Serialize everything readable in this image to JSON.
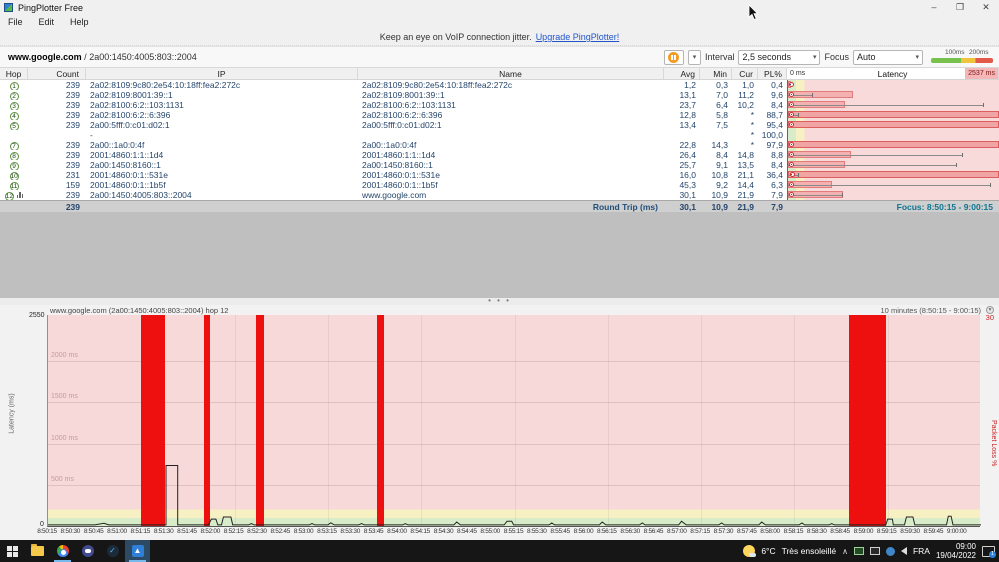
{
  "window": {
    "title": "PingPlotter Free",
    "minimize": "–",
    "maximize": "❐",
    "close": "✕"
  },
  "menu": {
    "items": [
      "File",
      "Edit",
      "Help"
    ]
  },
  "banner": {
    "text": "Keep an eye on VoIP connection jitter.",
    "link": "Upgrade PingPlotter!"
  },
  "target": {
    "host": "www.google.com",
    "separator": " / ",
    "address": "2a00:1450:4005:803::2004"
  },
  "controls": {
    "interval_label": "Interval",
    "interval_value": "2,5 seconds",
    "focus_label": "Focus",
    "focus_value": "Auto",
    "legend": {
      "low": "100ms",
      "high": "200ms"
    },
    "caret": "▾"
  },
  "table": {
    "headers": {
      "hop": "Hop",
      "count": "Count",
      "ip": "IP",
      "name": "Name",
      "avg": "Avg",
      "min": "Min",
      "cur": "Cur",
      "pl": "PL%",
      "latency": "Latency",
      "lat_min": "0 ms",
      "lat_max": "2537 ms"
    },
    "rows": [
      {
        "hop": "1",
        "count": "239",
        "ip": "2a02:8109:9c80:2e54:10:18ff:fea2:272c",
        "name": "2a02:8109:9c80:2e54:10:18ff:fea2:272c",
        "avg": "1,2",
        "min": "0,3",
        "cur": "1,0",
        "pl": "0,4",
        "bar": 0.012,
        "whisker": 0.012,
        "marker": 0.004,
        "graph_icon": false
      },
      {
        "hop": "2",
        "count": "239",
        "ip": "2a02:8109:8001:39::1",
        "name": "2a02:8109:8001:39::1",
        "avg": "13,1",
        "min": "7,0",
        "cur": "11,2",
        "pl": "9,6",
        "bar": 0.31,
        "whisker": 0.12,
        "marker": 0.006,
        "graph_icon": false
      },
      {
        "hop": "3",
        "count": "239",
        "ip": "2a02:8100:6:2::103:1131",
        "name": "2a02:8100:6:2::103:1131",
        "avg": "23,7",
        "min": "6,4",
        "cur": "10,2",
        "pl": "8,4",
        "bar": 0.27,
        "whisker": 0.93,
        "marker": 0.006,
        "graph_icon": false
      },
      {
        "hop": "4",
        "count": "239",
        "ip": "2a02:8100:6:2::6:396",
        "name": "2a02:8100:6:2::6:396",
        "avg": "12,8",
        "min": "5,8",
        "cur": "*",
        "pl": "88,7",
        "bar": 1,
        "whisker": 0.05,
        "marker": 0.006,
        "graph_icon": false
      },
      {
        "hop": "5",
        "count": "239",
        "ip": "2a00:5fff:0:c01:d02:1",
        "name": "2a00:5fff:0:c01:d02:1",
        "avg": "13,4",
        "min": "7,5",
        "cur": "*",
        "pl": "95,4",
        "bar": 1,
        "whisker": 0,
        "marker": 0.006,
        "graph_icon": false
      },
      {
        "hop": "",
        "count": "",
        "ip": "-",
        "name": "",
        "avg": "",
        "min": "",
        "cur": "*",
        "pl": "100,0",
        "bar": 0,
        "whisker": 0,
        "marker": -1,
        "graph_icon": false
      },
      {
        "hop": "7",
        "count": "239",
        "ip": "2a00::1a0:0:4f",
        "name": "2a00::1a0:0:4f",
        "avg": "22,8",
        "min": "14,3",
        "cur": "*",
        "pl": "97,9",
        "bar": 1,
        "whisker": 0,
        "marker": 0.006,
        "graph_icon": false
      },
      {
        "hop": "8",
        "count": "239",
        "ip": "2001:4860:1:1::1d4",
        "name": "2001:4860:1:1::1d4",
        "avg": "26,4",
        "min": "8,4",
        "cur": "14,8",
        "pl": "8,8",
        "bar": 0.3,
        "whisker": 0.83,
        "marker": 0.006,
        "graph_icon": false
      },
      {
        "hop": "9",
        "count": "239",
        "ip": "2a00:1450:8160::1",
        "name": "2a00:1450:8160::1",
        "avg": "25,7",
        "min": "9,1",
        "cur": "13,5",
        "pl": "8,4",
        "bar": 0.27,
        "whisker": 0.8,
        "marker": 0.006,
        "graph_icon": false
      },
      {
        "hop": "10",
        "count": "231",
        "ip": "2001:4860:0:1::531e",
        "name": "2001:4860:0:1::531e",
        "avg": "16,0",
        "min": "10,8",
        "cur": "21,1",
        "pl": "36,4",
        "bar": 1,
        "whisker": 0.05,
        "marker": 0.008,
        "graph_icon": false
      },
      {
        "hop": "11",
        "count": "159",
        "ip": "2001:4860:0:1::1b5f",
        "name": "2001:4860:0:1::1b5f",
        "avg": "45,3",
        "min": "9,2",
        "cur": "14,4",
        "pl": "6,3",
        "bar": 0.21,
        "whisker": 0.96,
        "marker": 0.006,
        "graph_icon": false
      },
      {
        "hop": "12",
        "count": "239",
        "ip": "2a00:1450:4005:803::2004",
        "name": "www.google.com",
        "avg": "30,1",
        "min": "10,9",
        "cur": "21,9",
        "pl": "7,9",
        "bar": 0.26,
        "whisker": 0.26,
        "marker": 0.006,
        "graph_icon": true
      }
    ],
    "summary": {
      "count": "239",
      "label": "Round Trip (ms)",
      "avg": "30,1",
      "min": "10,9",
      "cur": "21,9",
      "pl": "7,9",
      "focus": "Focus: 8:50:15 - 9:00:15"
    }
  },
  "splitter": {
    "handle": "• • •"
  },
  "chart_data": {
    "type": "line",
    "title": "www.google.com (2a00:1450:4005:803::2004) hop 12",
    "range_label": "10 minutes (8:50:15 - 9:00:15)",
    "ylabel_left": "Latency (ms)",
    "ylabel_right": "Packet Loss %",
    "y_max": "2550",
    "y_min": "0",
    "right_max": "30",
    "grid": [
      {
        "ms": 2000,
        "label": "2000 ms"
      },
      {
        "ms": 1500,
        "label": "1500 ms"
      },
      {
        "ms": 1000,
        "label": "1000 ms"
      },
      {
        "ms": 500,
        "label": "500 ms"
      }
    ],
    "ticks": [
      "8:50:15",
      "8:50:30",
      "8:50:45",
      "8:51:00",
      "8:51:15",
      "8:51:30",
      "8:51:45",
      "8:52:00",
      "8:52:15",
      "8:52:30",
      "8:52:45",
      "8:53:00",
      "8:53:15",
      "8:53:30",
      "8:53:45",
      "8:54:00",
      "8:54:15",
      "8:54:30",
      "8:54:45",
      "8:55:00",
      "8:55:15",
      "8:55:30",
      "8:55:45",
      "8:56:00",
      "8:56:15",
      "8:56:30",
      "8:56:45",
      "8:57:00",
      "8:57:15",
      "8:57:30",
      "8:57:45",
      "8:58:00",
      "8:58:15",
      "8:58:30",
      "8:58:45",
      "8:59:00",
      "8:59:15",
      "8:59:30",
      "8:59:45",
      "9:00:00"
    ],
    "loss_bars": [
      {
        "x": 0.0997,
        "w": 0.0257
      },
      {
        "x": 0.167,
        "w": 0.007
      },
      {
        "x": 0.223,
        "w": 0.008
      },
      {
        "x": 0.3526,
        "w": 0.008
      },
      {
        "x": 0.859,
        "w": 0.039
      }
    ],
    "line_points": [
      [
        0,
        25
      ],
      [
        0.05,
        25
      ],
      [
        0.06,
        45
      ],
      [
        0.065,
        25
      ],
      [
        0.095,
        25
      ],
      [
        0.1265,
        25
      ],
      [
        0.1265,
        740
      ],
      [
        0.139,
        740
      ],
      [
        0.139,
        25
      ],
      [
        0.172,
        25
      ],
      [
        0.175,
        95
      ],
      [
        0.18,
        95
      ],
      [
        0.182,
        25
      ],
      [
        0.186,
        25
      ],
      [
        0.188,
        120
      ],
      [
        0.196,
        120
      ],
      [
        0.198,
        25
      ],
      [
        0.215,
        25
      ],
      [
        0.218,
        42
      ],
      [
        0.221,
        25
      ],
      [
        0.28,
        25
      ],
      [
        0.283,
        42
      ],
      [
        0.286,
        25
      ],
      [
        0.3,
        25
      ],
      [
        0.303,
        50
      ],
      [
        0.307,
        25
      ],
      [
        0.333,
        25
      ],
      [
        0.336,
        42
      ],
      [
        0.339,
        25
      ],
      [
        0.38,
        25
      ],
      [
        0.383,
        40
      ],
      [
        0.386,
        25
      ],
      [
        0.435,
        25
      ],
      [
        0.438,
        60
      ],
      [
        0.442,
        25
      ],
      [
        0.489,
        25
      ],
      [
        0.492,
        70
      ],
      [
        0.497,
        70
      ],
      [
        0.499,
        25
      ],
      [
        0.537,
        25
      ],
      [
        0.54,
        48
      ],
      [
        0.543,
        25
      ],
      [
        0.591,
        25
      ],
      [
        0.594,
        60
      ],
      [
        0.598,
        25
      ],
      [
        0.634,
        25
      ],
      [
        0.637,
        48
      ],
      [
        0.64,
        25
      ],
      [
        0.676,
        25
      ],
      [
        0.679,
        70
      ],
      [
        0.684,
        25
      ],
      [
        0.719,
        25
      ],
      [
        0.722,
        48
      ],
      [
        0.725,
        25
      ],
      [
        0.762,
        25
      ],
      [
        0.765,
        60
      ],
      [
        0.769,
        25
      ],
      [
        0.805,
        25
      ],
      [
        0.808,
        48
      ],
      [
        0.811,
        25
      ],
      [
        0.837,
        25
      ],
      [
        0.84,
        40
      ],
      [
        0.843,
        25
      ],
      [
        0.898,
        25
      ],
      [
        0.9,
        95
      ],
      [
        0.905,
        95
      ],
      [
        0.906,
        25
      ],
      [
        0.918,
        25
      ],
      [
        0.92,
        120
      ],
      [
        0.927,
        120
      ],
      [
        0.929,
        25
      ],
      [
        0.963,
        25
      ],
      [
        0.965,
        130
      ],
      [
        0.968,
        130
      ],
      [
        0.97,
        25
      ],
      [
        1,
        25
      ]
    ],
    "colors": {
      "loss_bar": "#ee0f0f",
      "zone_ok": "#d8ecc9",
      "zone_warn": "#f7f0c3",
      "zone_bad": "#f8d9d9",
      "line": "#222222"
    }
  },
  "taskbar": {
    "tray": {
      "temp": "6°C",
      "weather": "Très ensoleillé",
      "chevron": "∧",
      "lang": "FRA",
      "time": "09:00",
      "date": "19/04/2022",
      "badge": "1"
    }
  }
}
